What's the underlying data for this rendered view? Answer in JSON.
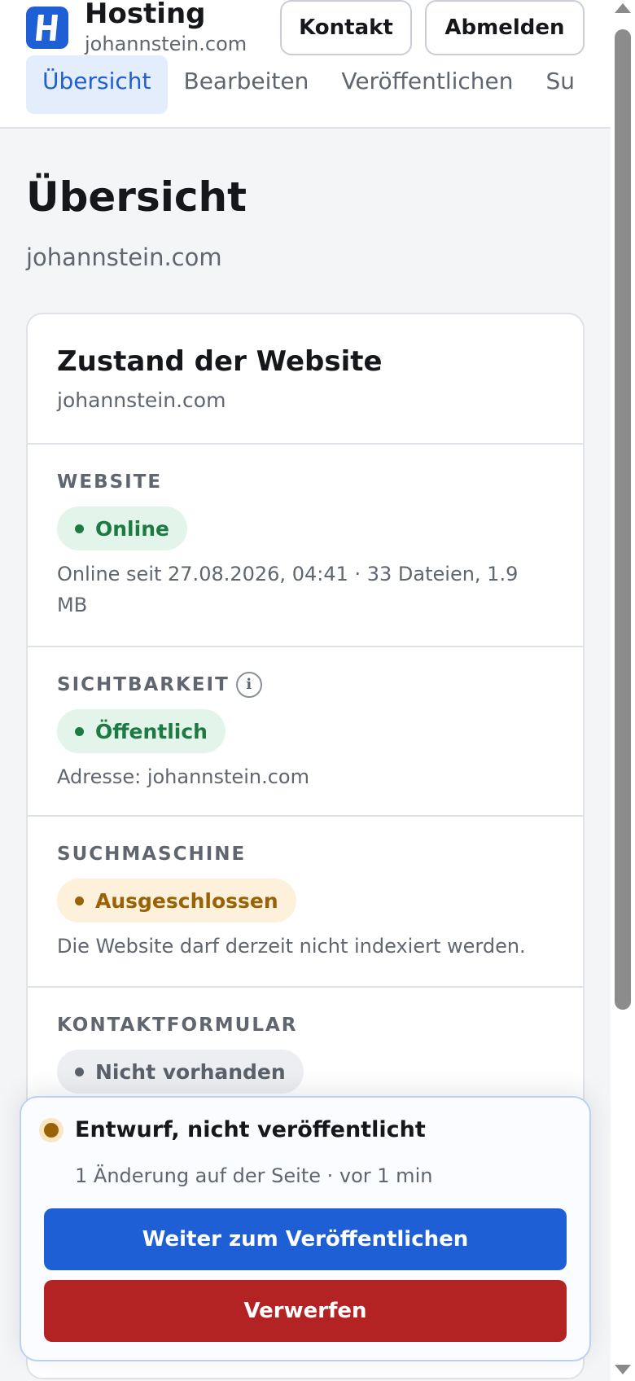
{
  "header": {
    "brand_title": "Hosting",
    "brand_domain": "johannstein.com",
    "logo_letter": "H",
    "contact_label": "Kontakt",
    "logout_label": "Abmelden"
  },
  "tabs": [
    {
      "label": "Übersicht",
      "active": true
    },
    {
      "label": "Bearbeiten",
      "active": false
    },
    {
      "label": "Veröffentlichen",
      "active": false
    },
    {
      "label": "Su",
      "active": false
    }
  ],
  "page": {
    "title": "Übersicht",
    "subtitle": "johannstein.com"
  },
  "card": {
    "title": "Zustand der Website",
    "subtitle": "johannstein.com",
    "sections": {
      "website": {
        "label": "WEBSITE",
        "badge": "Online",
        "text": "Online seit 27.08.2026, 04:41 · 33 Dateien, 1.9 MB"
      },
      "visibility": {
        "label": "SICHTBARKEIT",
        "info_icon": "i",
        "badge": "Öffentlich",
        "text": "Adresse: johannstein.com"
      },
      "search_engine": {
        "label": "SUCHMASCHINE",
        "badge": "Ausgeschlossen",
        "text": "Die Website darf derzeit nicht indexiert werden."
      },
      "contact_form": {
        "label": "KONTAKTFORMULAR",
        "badge": "Nicht vorhanden"
      }
    }
  },
  "draft": {
    "title": "Entwurf, nicht veröffentlicht",
    "subtitle": "1 Änderung auf der Seite · vor 1 min",
    "publish_label": "Weiter zum Veröffentlichen",
    "discard_label": "Verwerfen"
  },
  "colors": {
    "accent": "#1f5fd6",
    "danger": "#b42323",
    "success": "#1d7a43",
    "warning": "#9a6206"
  },
  "icons": [
    "hosting-logo-icon",
    "info-icon",
    "status-dot-icon"
  ]
}
